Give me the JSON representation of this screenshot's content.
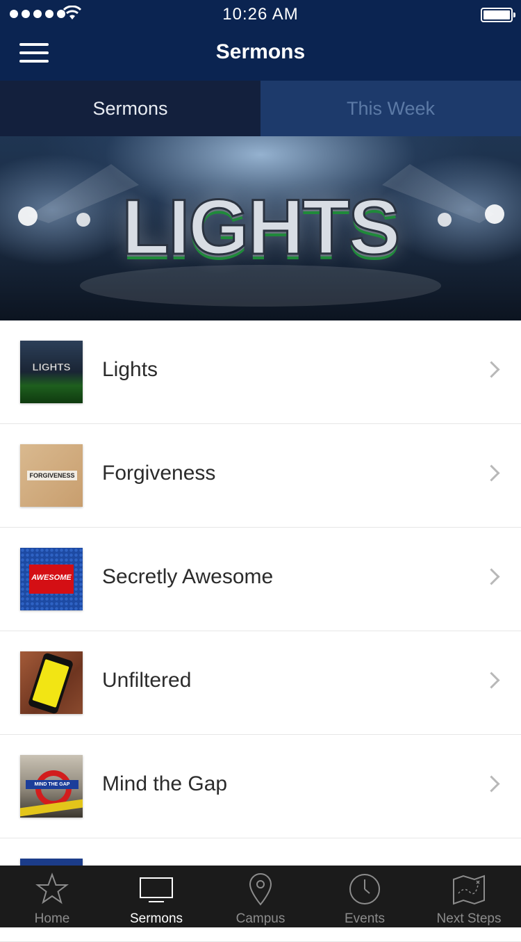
{
  "status_bar": {
    "time": "10:26 AM"
  },
  "nav": {
    "title": "Sermons"
  },
  "tabs": [
    {
      "label": "Sermons",
      "active": true
    },
    {
      "label": "This Week",
      "active": false
    }
  ],
  "banner": {
    "title": "LIGHTS"
  },
  "sermons": [
    {
      "title": "Lights",
      "thumb_text": "LIGHTS"
    },
    {
      "title": "Forgiveness",
      "thumb_text": "FORGIVENESS"
    },
    {
      "title": "Secretly Awesome",
      "thumb_text": "AWESOME"
    },
    {
      "title": "Unfiltered",
      "thumb_text": ""
    },
    {
      "title": "Mind the Gap",
      "thumb_text": "MIND THE GAP"
    }
  ],
  "tab_bar": {
    "items": [
      {
        "label": "Home",
        "icon": "star-icon",
        "active": false
      },
      {
        "label": "Sermons",
        "icon": "monitor-icon",
        "active": true
      },
      {
        "label": "Campus",
        "icon": "map-pin-icon",
        "active": false
      },
      {
        "label": "Events",
        "icon": "clock-icon",
        "active": false
      },
      {
        "label": "Next Steps",
        "icon": "map-icon",
        "active": false
      }
    ]
  }
}
